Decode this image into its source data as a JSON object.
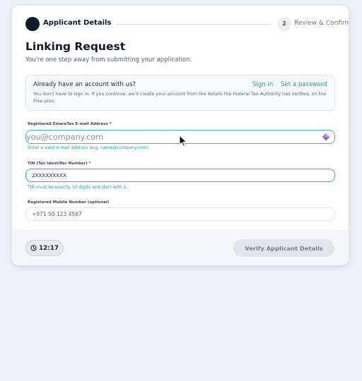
{
  "stepper": {
    "step1_label": "Applicant Details",
    "step2_number": "2",
    "step2_label": "Review & Confirm"
  },
  "header": {
    "title": "Linking Request",
    "subtitle": "You're one step away from submitting your application."
  },
  "account_prompt": {
    "question": "Already have an account with us?",
    "sign_in": "Sign in",
    "set_password": "Set a password",
    "description": "You don't have to sign in. If you continue, we'll create your account from the details the Federal Tax Authority has verified, on the Free plan."
  },
  "form": {
    "email": {
      "label": "Registered EmaraTax E-mail Address *",
      "value": "",
      "placeholder": "you@company.com",
      "hint": "Enter a valid e-mail address (e.g. name@company.com)."
    },
    "tin": {
      "label": "TIN (Tax Identifier Number) *",
      "value": "2XXXXXXXXX",
      "hint": "TIN must be exactly 10 digits and start with 1."
    },
    "mobile": {
      "label": "Registered Mobile Number (optional)",
      "value": "",
      "placeholder": "+971 50 123 4567"
    }
  },
  "footer": {
    "timer": "12:17",
    "verify_label": "Verify Applicant Details"
  },
  "colors": {
    "accent": "#13a6a0",
    "dark": "#0f1a2b",
    "disabled_button": "#e2e5ea"
  }
}
